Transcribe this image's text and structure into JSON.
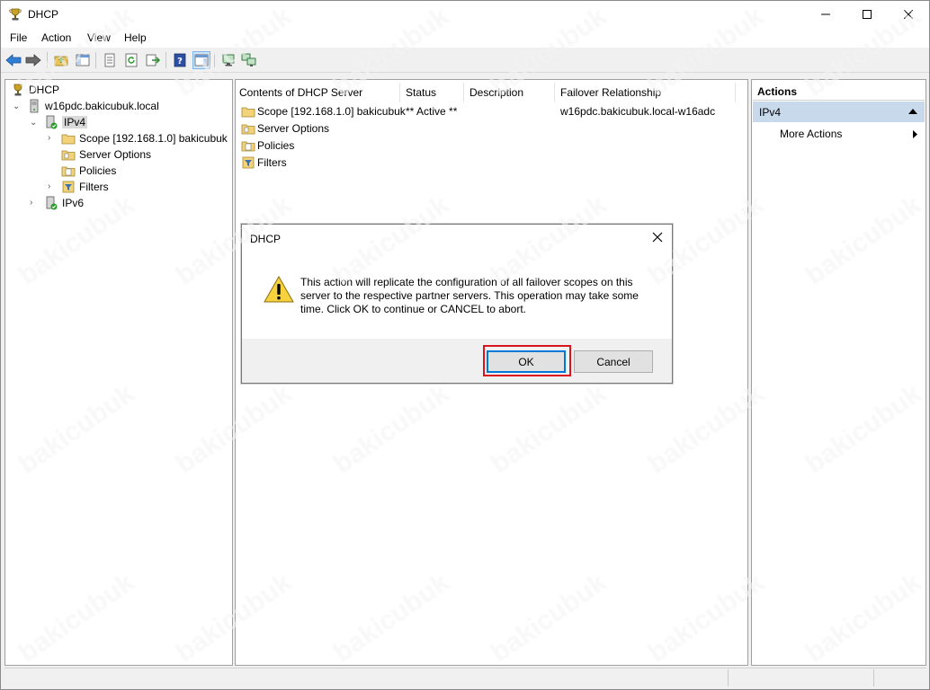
{
  "window": {
    "title": "DHCP",
    "icon": "dhcp-trophy-icon",
    "controls": [
      "minimize-icon",
      "maximize-icon",
      "close-icon"
    ]
  },
  "menubar": {
    "items": [
      {
        "label": "File"
      },
      {
        "label": "Action"
      },
      {
        "label": "View"
      },
      {
        "label": "Help"
      }
    ]
  },
  "toolbar": {
    "buttons": [
      "back-icon",
      "forward-icon",
      "up-folder-icon",
      "show-hide-tree-icon",
      "export-list-icon",
      "refresh-icon",
      "export-icon",
      "help-icon",
      "show-hide-action-pane-icon",
      "monitor-icon",
      "network-icon"
    ]
  },
  "tree": {
    "root": "DHCP",
    "server": "w16pdc.bakicubuk.local",
    "ipv4": "IPv4",
    "scope": "Scope [192.168.1.0] bakicubuk",
    "server_options": "Server Options",
    "policies": "Policies",
    "filters": "Filters",
    "ipv6": "IPv6"
  },
  "content": {
    "columns": [
      "Contents of DHCP Server",
      "Status",
      "Description",
      "Failover Relationship"
    ],
    "rows": [
      {
        "name": "Scope [192.168.1.0] bakicubuk",
        "status": "** Active **",
        "description": "",
        "failover": "w16pdc.bakicubuk.local-w16adc"
      },
      {
        "name": "Server Options",
        "status": "",
        "description": "",
        "failover": ""
      },
      {
        "name": "Policies",
        "status": "",
        "description": "",
        "failover": ""
      },
      {
        "name": "Filters",
        "status": "",
        "description": "",
        "failover": ""
      }
    ]
  },
  "actions": {
    "title": "Actions",
    "section": "IPv4",
    "more_actions": "More Actions"
  },
  "dialog": {
    "title": "DHCP",
    "message": "This action will replicate the configuration of all failover scopes on this server to the respective partner servers. This operation may take some time. Click OK to continue or CANCEL to abort.",
    "ok_label": "OK",
    "cancel_label": "Cancel",
    "icon": "warning-icon"
  },
  "watermark": "bakicubuk",
  "colors": {
    "selection": "#c9d9ec",
    "highlight_border": "#d9141c",
    "default_button_border": "#0078d7"
  }
}
